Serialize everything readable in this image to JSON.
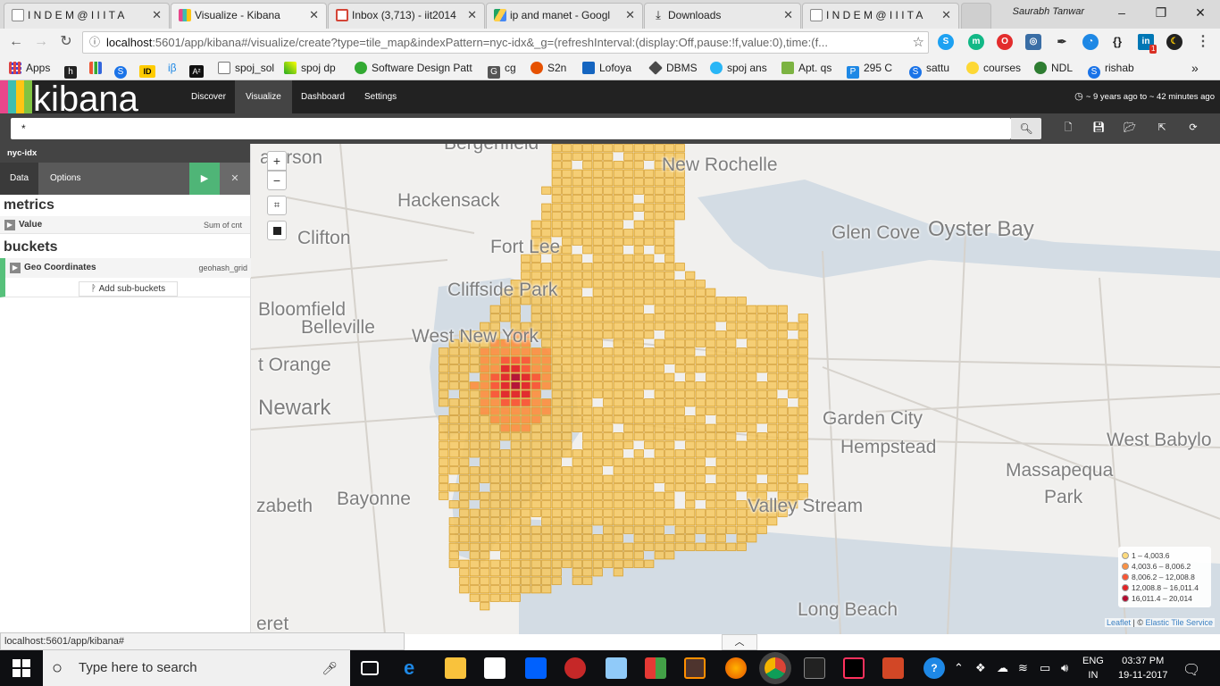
{
  "browser": {
    "tabs": [
      {
        "title": "I N D E M @ I I I T A",
        "color": "#8a8a8a"
      },
      {
        "title": "Visualize - Kibana",
        "color": "#e8478b"
      },
      {
        "title": "Inbox (3,713) - iit2014",
        "color": "#d44638"
      },
      {
        "title": "ip and manet - Googl",
        "color": "#1fa463"
      },
      {
        "title": "Downloads",
        "color": "#555555"
      },
      {
        "title": "I N D E M @ I I I T A",
        "color": "#8a8a8a"
      }
    ],
    "tab_close": "✕",
    "user": "Saurabh Tanwar",
    "url_host": "localhost",
    "url_rest": ":5601/app/kibana#/visualize/create?type=tile_map&indexPattern=nyc-idx&_g=(refreshInterval:(display:Off,pause:!f,value:0),time:(f...",
    "bookmarks": [
      "Apps",
      "h",
      "",
      "S",
      "ID",
      "iβ",
      "A²",
      "spoj_sol",
      "spoj dp",
      "Software Design Patt",
      "cg",
      "S2n",
      "Lofoya",
      "DBMS",
      "spoj ans",
      "Apt. qs",
      "295 C",
      "sattu",
      "courses",
      "NDL",
      "rishab"
    ],
    "bookmarks_more": "»",
    "ext_badge": "1"
  },
  "kibana": {
    "logo": "kibana",
    "nav": [
      "Discover",
      "Visualize",
      "Dashboard",
      "Settings"
    ],
    "time_range": "~ 9 years ago to ~ 42 minutes ago",
    "query": "*",
    "index": "nyc-idx",
    "side_tabs": [
      "Data",
      "Options"
    ],
    "apply_icon": "▶",
    "discard_icon": "✕",
    "metrics_title": "metrics",
    "metric_name": "Value",
    "metric_agg": "Sum of cnt",
    "buckets_title": "buckets",
    "bucket_name": "Geo Coordinates",
    "bucket_agg": "geohash_grid",
    "add_sub": "Add sub-buckets"
  },
  "map": {
    "zoom_in": "+",
    "zoom_out": "−",
    "labels": [
      "Bergenfield",
      "New Rochelle",
      "aterson",
      "Hackensack",
      "Clifton",
      "Glen Cove",
      "Oyster Bay",
      "Fort Lee",
      "Cliffside Park",
      "Bloomfield",
      "Belleville",
      "West New York",
      "t Orange",
      "Newark",
      "Garden City",
      "Hempstead",
      "West Babylo",
      "Massapequa",
      "Park",
      "Bayonne",
      "zabeth",
      "Valley Stream",
      "Long Beach",
      "eret"
    ],
    "legend": [
      {
        "label": "1 – 4,003.6",
        "color": "#fed976"
      },
      {
        "label": "4,003.6 – 8,006.2",
        "color": "#fd8d3c"
      },
      {
        "label": "8,006.2 – 12,008.8",
        "color": "#fc4e2a"
      },
      {
        "label": "12,008.8 – 16,011.4",
        "color": "#e31a1c"
      },
      {
        "label": "16,011.4 – 20,014",
        "color": "#b10026"
      }
    ],
    "attribution_leaflet": "Leaflet",
    "attribution_sep": " | © ",
    "attribution_tiles": "Elastic Tile Service"
  },
  "status_url": "localhost:5601/app/kibana#",
  "taskbar": {
    "search_placeholder": "Type here to search",
    "lang_line1": "ENG",
    "lang_line2": "IN",
    "time": "03:37 PM",
    "date": "19-11-2017"
  }
}
